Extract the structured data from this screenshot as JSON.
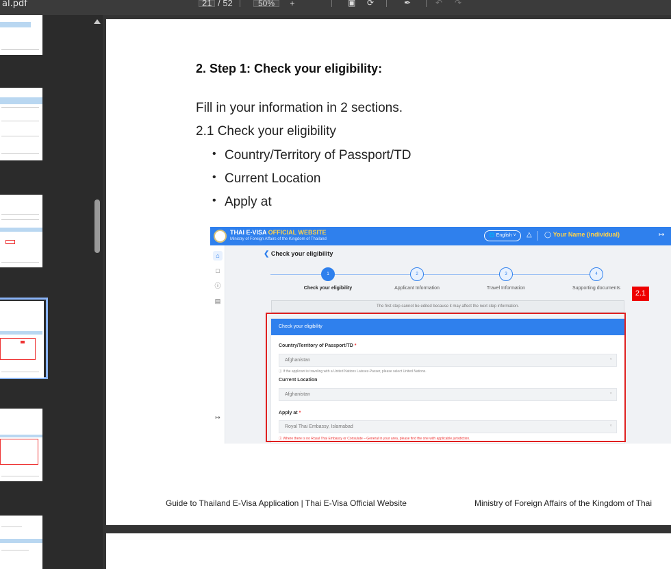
{
  "toolbar": {
    "filename": "al.pdf",
    "page_current": "21",
    "page_total": "/ 52",
    "zoom": "50%",
    "zoom_plus": "+",
    "colors": {
      "bg": "#3b3b3b",
      "text": "#e8e8e8"
    }
  },
  "document": {
    "heading": "2. Step 1: Check your eligibility:",
    "intro": "Fill in your information in 2 sections.",
    "subheading": "2.1 Check your eligibility",
    "bullets": [
      "Country/Territory of Passport/TD",
      "Current Location",
      "Apply at"
    ],
    "annotation_tag": "2.1",
    "footer_left": "Guide to Thailand E-Visa Application | Thai E-Visa Official Website",
    "footer_right": "Ministry of Foreign Affairs of the Kingdom of Thai"
  },
  "screenshot": {
    "site_title_a": "THAI E-VISA ",
    "site_title_b": "OFFICIAL WEBSITE",
    "site_subtitle": "Ministry of Foreign Affairs of the Kingdom of Thailand",
    "language": "English",
    "user_name": "Your Name",
    "user_type": "(individual)",
    "back_label": "Check your eligibility",
    "steps": [
      {
        "num": "1",
        "label": "Check your eligibility"
      },
      {
        "num": "2",
        "label": "Applicant Information"
      },
      {
        "num": "3",
        "label": "Travel Information"
      },
      {
        "num": "4",
        "label": "Supporting documents"
      }
    ],
    "notice": "The first step cannot be edited because it may affect the next step information.",
    "form_header": "Check your eligibility",
    "fields": [
      {
        "label": "Country/Territory of Passport/TD",
        "required": "*",
        "value": "Afghanistan",
        "hint": "If the applicant is traveling with a United Nations Laissez-Passer, please select United Nations."
      },
      {
        "label": "Current Location",
        "required": "",
        "value": "Afghanistan",
        "hint": ""
      },
      {
        "label": "Apply at",
        "required": "*",
        "value": "Royal Thai Embassy, Islamabad",
        "hint": "Where there is no Royal Thai Embassy or Consulate – General in your area, please find the one with applicable jurisdiction."
      }
    ],
    "colors": {
      "brand": "#2f80ed",
      "highlight": "#ffd24a",
      "annotation": "#e02020"
    }
  }
}
